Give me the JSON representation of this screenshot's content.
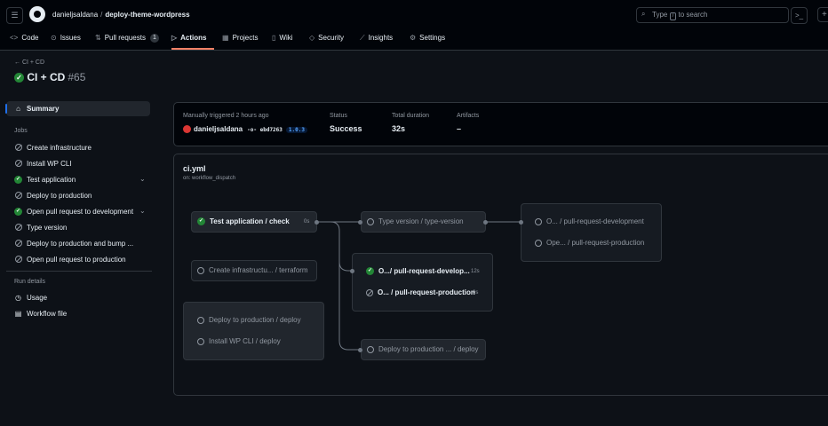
{
  "header": {
    "owner": "danieljsaldana",
    "repo": "deploy-theme-wordpress",
    "search_placeholder_before": "Type",
    "search_key": "/",
    "search_placeholder_after": "to search"
  },
  "tabs": [
    {
      "label": "Code",
      "icon": "code-icon"
    },
    {
      "label": "Issues",
      "icon": "issue-icon"
    },
    {
      "label": "Pull requests",
      "icon": "pull-request-icon",
      "count": "1"
    },
    {
      "label": "Actions",
      "icon": "play-icon",
      "active": true
    },
    {
      "label": "Projects",
      "icon": "table-icon"
    },
    {
      "label": "Wiki",
      "icon": "book-icon"
    },
    {
      "label": "Security",
      "icon": "shield-icon"
    },
    {
      "label": "Insights",
      "icon": "graph-icon"
    },
    {
      "label": "Settings",
      "icon": "gear-icon"
    }
  ],
  "run": {
    "back_label": "CI + CD",
    "title": "CI + CD",
    "number": "#65"
  },
  "sidebar": {
    "summary_label": "Summary",
    "jobs_heading": "Jobs",
    "jobs": [
      {
        "label": "Create infrastructure",
        "status": "skipped"
      },
      {
        "label": "Install WP CLI",
        "status": "skipped"
      },
      {
        "label": "Test application",
        "status": "success",
        "expandable": true
      },
      {
        "label": "Deploy to production",
        "status": "skipped"
      },
      {
        "label": "Open pull request to development",
        "status": "success",
        "expandable": true
      },
      {
        "label": "Type version",
        "status": "skipped"
      },
      {
        "label": "Deploy to production and bump ...",
        "status": "skipped"
      },
      {
        "label": "Open pull request to production",
        "status": "skipped"
      }
    ],
    "details_heading": "Run details",
    "details": [
      {
        "label": "Usage",
        "icon": "stopwatch-icon"
      },
      {
        "label": "Workflow file",
        "icon": "file-icon"
      }
    ]
  },
  "summary": {
    "trigger": "Manually triggered 2 hours ago",
    "actor": "danieljsaldana",
    "commit": "ebd7263",
    "ref": "1.0.3",
    "status_label": "Status",
    "status_value": "Success",
    "duration_label": "Total duration",
    "duration_value": "32s",
    "artifacts_label": "Artifacts",
    "artifacts_value": "–"
  },
  "graph": {
    "file": "ci.yml",
    "event": "on: workflow_dispatch",
    "jobs": {
      "test_check": {
        "label": "Test application / check",
        "duration": "0s"
      },
      "type_version": {
        "label": "Type version / type-version"
      },
      "pr_dev_right": {
        "label": "O... / pull-request-development"
      },
      "pr_prod_right": {
        "label": "Ope... / pull-request-production"
      },
      "terraform": {
        "label": "Create infrastructu... / terraform"
      },
      "pr_dev_mid": {
        "label": "O.../ pull-request-develop...",
        "duration": "12s"
      },
      "pr_prod_mid": {
        "label": "O... / pull-request-production",
        "duration": "0s"
      },
      "deploy_prod": {
        "label": "Deploy to production / deploy"
      },
      "wp_cli": {
        "label": "Install WP CLI / deploy"
      },
      "deploy_bump": {
        "label": "Deploy to production ... / deploy"
      }
    }
  }
}
